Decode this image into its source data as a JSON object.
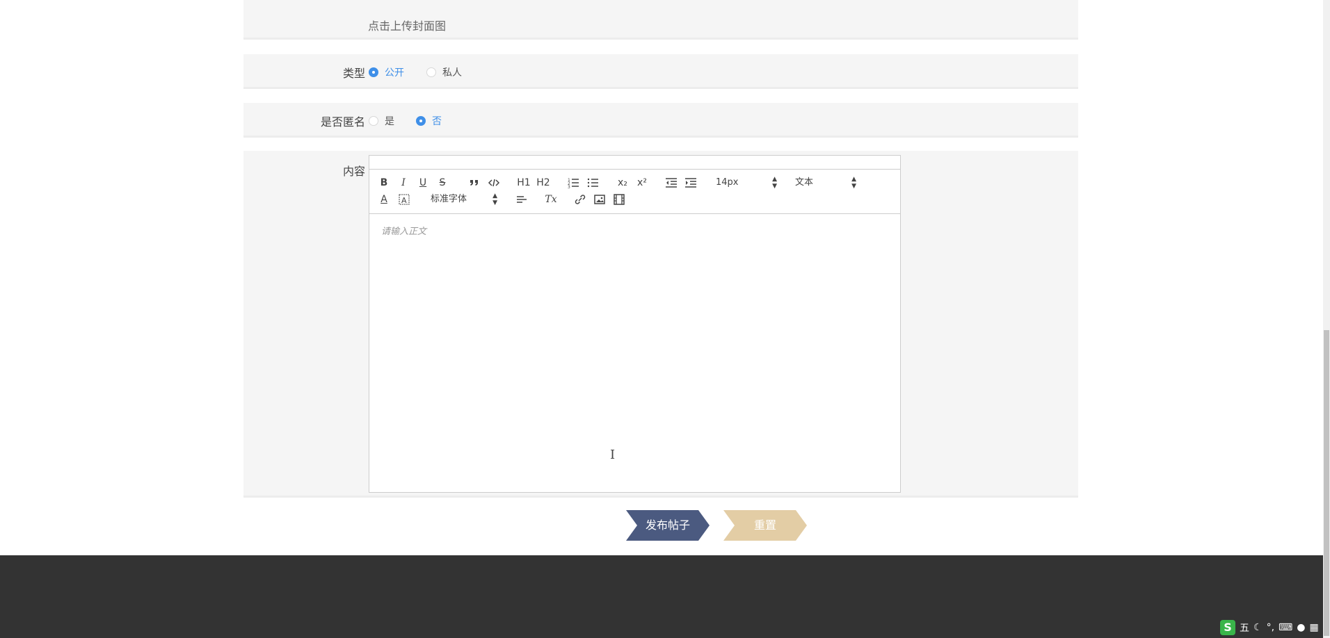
{
  "upload": {
    "hint": "点击上传封面图"
  },
  "type_field": {
    "label": "类型",
    "options": [
      {
        "label": "公开",
        "checked": true
      },
      {
        "label": "私人",
        "checked": false
      }
    ]
  },
  "anon_field": {
    "label": "是否匿名",
    "options": [
      {
        "label": "是",
        "checked": false
      },
      {
        "label": "否",
        "checked": true
      }
    ]
  },
  "content_field": {
    "label": "内容",
    "editor": {
      "toolbar": {
        "bold": "B",
        "italic": "I",
        "underline": "U",
        "strike": "S",
        "blockquote_icon": "quote-icon",
        "code_icon": "code-icon",
        "h1": "H1",
        "h2": "H2",
        "ordered_list_icon": "ordered-list-icon",
        "bullet_list_icon": "bullet-list-icon",
        "subscript": "x₂",
        "superscript": "x²",
        "outdent_icon": "outdent-icon",
        "indent_icon": "indent-icon",
        "size_picker": "14px",
        "header_picker": "文本",
        "font_color": "A",
        "font_picker": "标准字体",
        "align_icon": "align-left-icon",
        "clean": "Tx",
        "link_icon": "link-icon",
        "image_icon": "image-icon",
        "video_icon": "video-icon"
      },
      "placeholder": "请输入正文"
    }
  },
  "actions": {
    "submit_label": "发布帖子",
    "reset_label": "重置",
    "submit_color": "#4b5a80",
    "reset_color": "#e3cda5"
  },
  "ime": {
    "logo": "S",
    "mode": "五"
  }
}
